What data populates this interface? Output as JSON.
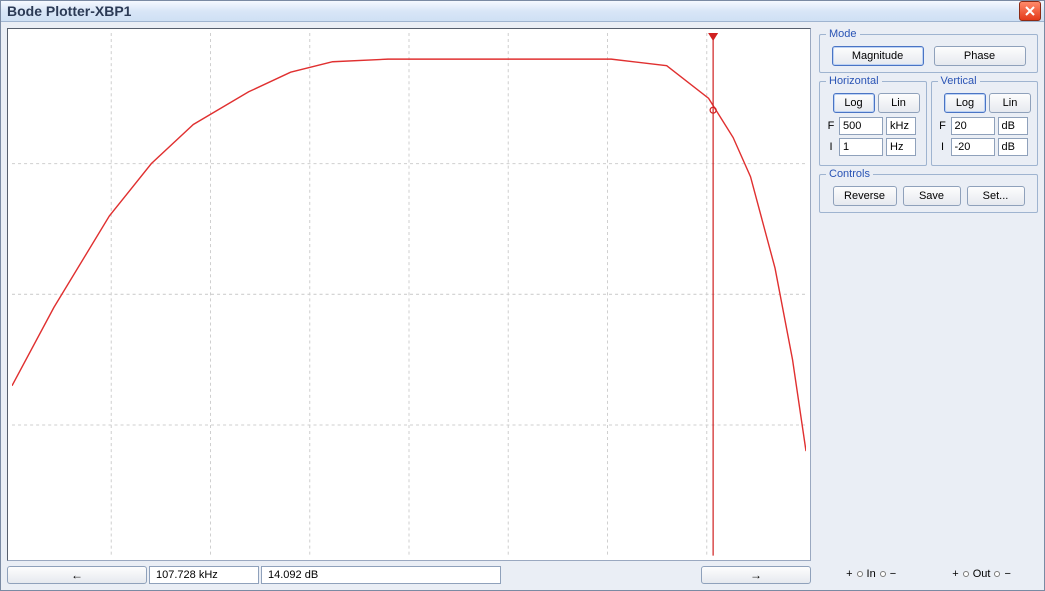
{
  "window": {
    "title": "Bode Plotter-XBP1"
  },
  "mode": {
    "legend": "Mode",
    "magnitude": "Magnitude",
    "phase": "Phase"
  },
  "horizontal": {
    "legend": "Horizontal",
    "log": "Log",
    "lin": "Lin",
    "F_label": "F",
    "F_value": "500",
    "F_unit": "kHz",
    "I_label": "I",
    "I_value": "1",
    "I_unit": "Hz"
  },
  "vertical": {
    "legend": "Vertical",
    "log": "Log",
    "lin": "Lin",
    "F_label": "F",
    "F_value": "20",
    "F_unit": "dB",
    "I_label": "I",
    "I_value": "-20",
    "I_unit": "dB"
  },
  "controls": {
    "legend": "Controls",
    "reverse": "Reverse",
    "save": "Save",
    "set": "Set..."
  },
  "io": {
    "in": "In",
    "out": "Out",
    "plus": "+",
    "minus": "−"
  },
  "footer": {
    "freq": "107.728 kHz",
    "mag": "14.092 dB",
    "left_arrow": "←",
    "right_arrow": "→"
  },
  "chart_data": {
    "type": "line",
    "xlabel": "",
    "ylabel": "",
    "x_scale": "log",
    "x_range_hz": [
      1,
      500000
    ],
    "y_range_db": [
      -20,
      20
    ],
    "cursor_x_hz": 107728,
    "cursor_y_db": 14.092,
    "series": [
      {
        "name": "Magnitude",
        "color": "#e03030",
        "x_hz": [
          1,
          2,
          5,
          10,
          20,
          50,
          100,
          200,
          500,
          1000,
          2000,
          5000,
          10000,
          20000,
          50000,
          100000,
          150000,
          200000,
          300000,
          400000,
          500000
        ],
        "y_db": [
          -7,
          -1,
          6,
          10,
          13,
          15.5,
          17,
          17.8,
          18,
          18,
          18,
          18,
          18,
          18,
          17.5,
          15,
          12,
          9,
          2,
          -5,
          -12
        ]
      }
    ],
    "grid": {
      "v_lines_norm": [
        0.125,
        0.25,
        0.375,
        0.5,
        0.625,
        0.75,
        0.875
      ],
      "h_lines_norm": [
        0.25,
        0.5,
        0.75
      ]
    }
  }
}
